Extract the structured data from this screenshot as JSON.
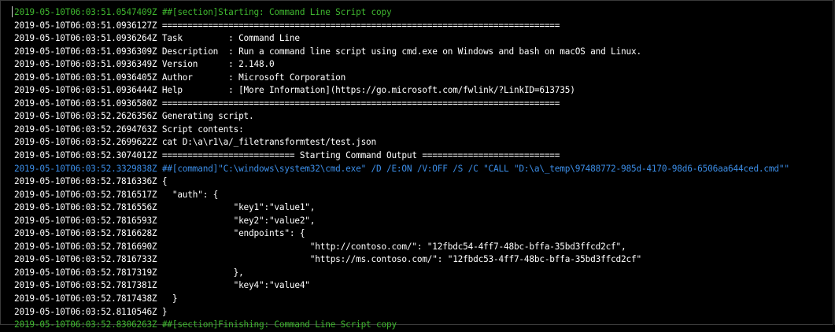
{
  "log": {
    "lines": [
      {
        "kind": "section",
        "text": "2019-05-10T06:03:51.0547409Z ##[section]Starting: Command Line Script copy"
      },
      {
        "kind": "white",
        "text": "2019-05-10T06:03:51.0936127Z =============================================================================="
      },
      {
        "kind": "white",
        "text": "2019-05-10T06:03:51.0936264Z Task         : Command Line"
      },
      {
        "kind": "white",
        "text": "2019-05-10T06:03:51.0936309Z Description  : Run a command line script using cmd.exe on Windows and bash on macOS and Linux."
      },
      {
        "kind": "white",
        "text": "2019-05-10T06:03:51.0936349Z Version      : 2.148.0"
      },
      {
        "kind": "white",
        "text": "2019-05-10T06:03:51.0936405Z Author       : Microsoft Corporation"
      },
      {
        "kind": "white",
        "text": "2019-05-10T06:03:51.0936444Z Help         : [More Information](https://go.microsoft.com/fwlink/?LinkID=613735)"
      },
      {
        "kind": "white",
        "text": "2019-05-10T06:03:51.0936580Z =============================================================================="
      },
      {
        "kind": "white",
        "text": "2019-05-10T06:03:52.2626356Z Generating script."
      },
      {
        "kind": "white",
        "text": "2019-05-10T06:03:52.2694763Z Script contents:"
      },
      {
        "kind": "white",
        "text": "2019-05-10T06:03:52.2699622Z cat D:\\a\\r1\\a/_filetransformtest/test.json"
      },
      {
        "kind": "white",
        "text": "2019-05-10T06:03:52.3074012Z ========================== Starting Command Output ==========================="
      },
      {
        "kind": "command",
        "text": "2019-05-10T06:03:52.3329838Z ##[command]\"C:\\windows\\system32\\cmd.exe\" /D /E:ON /V:OFF /S /C \"CALL \"D:\\a\\_temp\\97488772-985d-4170-98d6-6506aa644ced.cmd\"\""
      },
      {
        "kind": "white",
        "text": "2019-05-10T06:03:52.7816336Z {"
      },
      {
        "kind": "white",
        "text": "2019-05-10T06:03:52.7816517Z   \"auth\": {"
      },
      {
        "kind": "white",
        "text": "2019-05-10T06:03:52.7816556Z               \"key1\":\"value1\","
      },
      {
        "kind": "white",
        "text": "2019-05-10T06:03:52.7816593Z               \"key2\":\"value2\","
      },
      {
        "kind": "white",
        "text": "2019-05-10T06:03:52.7816628Z               \"endpoints\": {"
      },
      {
        "kind": "white",
        "text": "2019-05-10T06:03:52.7816690Z                              \"http://contoso.com/\": \"12fbdc54-4ff7-48bc-bffa-35bd3ffcd2cf\","
      },
      {
        "kind": "white",
        "text": "2019-05-10T06:03:52.7816733Z                              \"https://ms.contoso.com/\": \"12fbdc53-4ff7-48bc-bffa-35bd3ffcd2cf\""
      },
      {
        "kind": "white",
        "text": "2019-05-10T06:03:52.7817319Z               },"
      },
      {
        "kind": "white",
        "text": "2019-05-10T06:03:52.7817381Z               \"key4\":\"value4\""
      },
      {
        "kind": "white",
        "text": "2019-05-10T06:03:52.7817438Z   }"
      },
      {
        "kind": "white",
        "text": "2019-05-10T06:03:52.8110546Z }"
      },
      {
        "kind": "section",
        "text": "2019-05-10T06:03:52.8306263Z ##[section]Finishing: Command Line Script copy"
      }
    ]
  },
  "colors": {
    "background": "#000000",
    "text": "#ffffff",
    "section": "#3fb62f",
    "command": "#3c8ee8"
  }
}
